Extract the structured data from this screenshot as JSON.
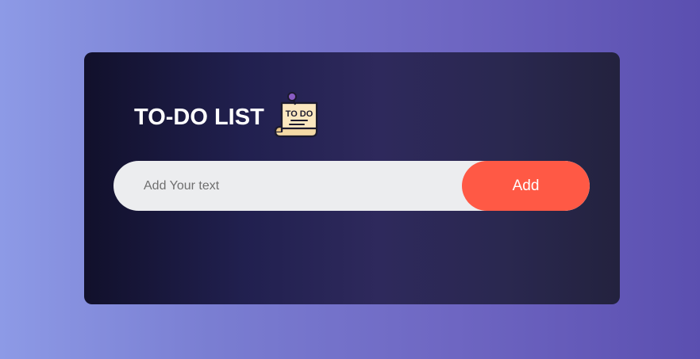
{
  "app": {
    "title": "TO-DO LIST",
    "icon": "todo-note-icon"
  },
  "input": {
    "placeholder": "Add Your text",
    "value": ""
  },
  "add_button": {
    "label": "Add"
  },
  "tasks": [],
  "colors": {
    "accent": "#ff5945",
    "card_bg": "#21204f",
    "input_bg": "#ecedef",
    "page_bg_start": "#8d9ae6",
    "page_bg_end": "#5b4fb0"
  }
}
